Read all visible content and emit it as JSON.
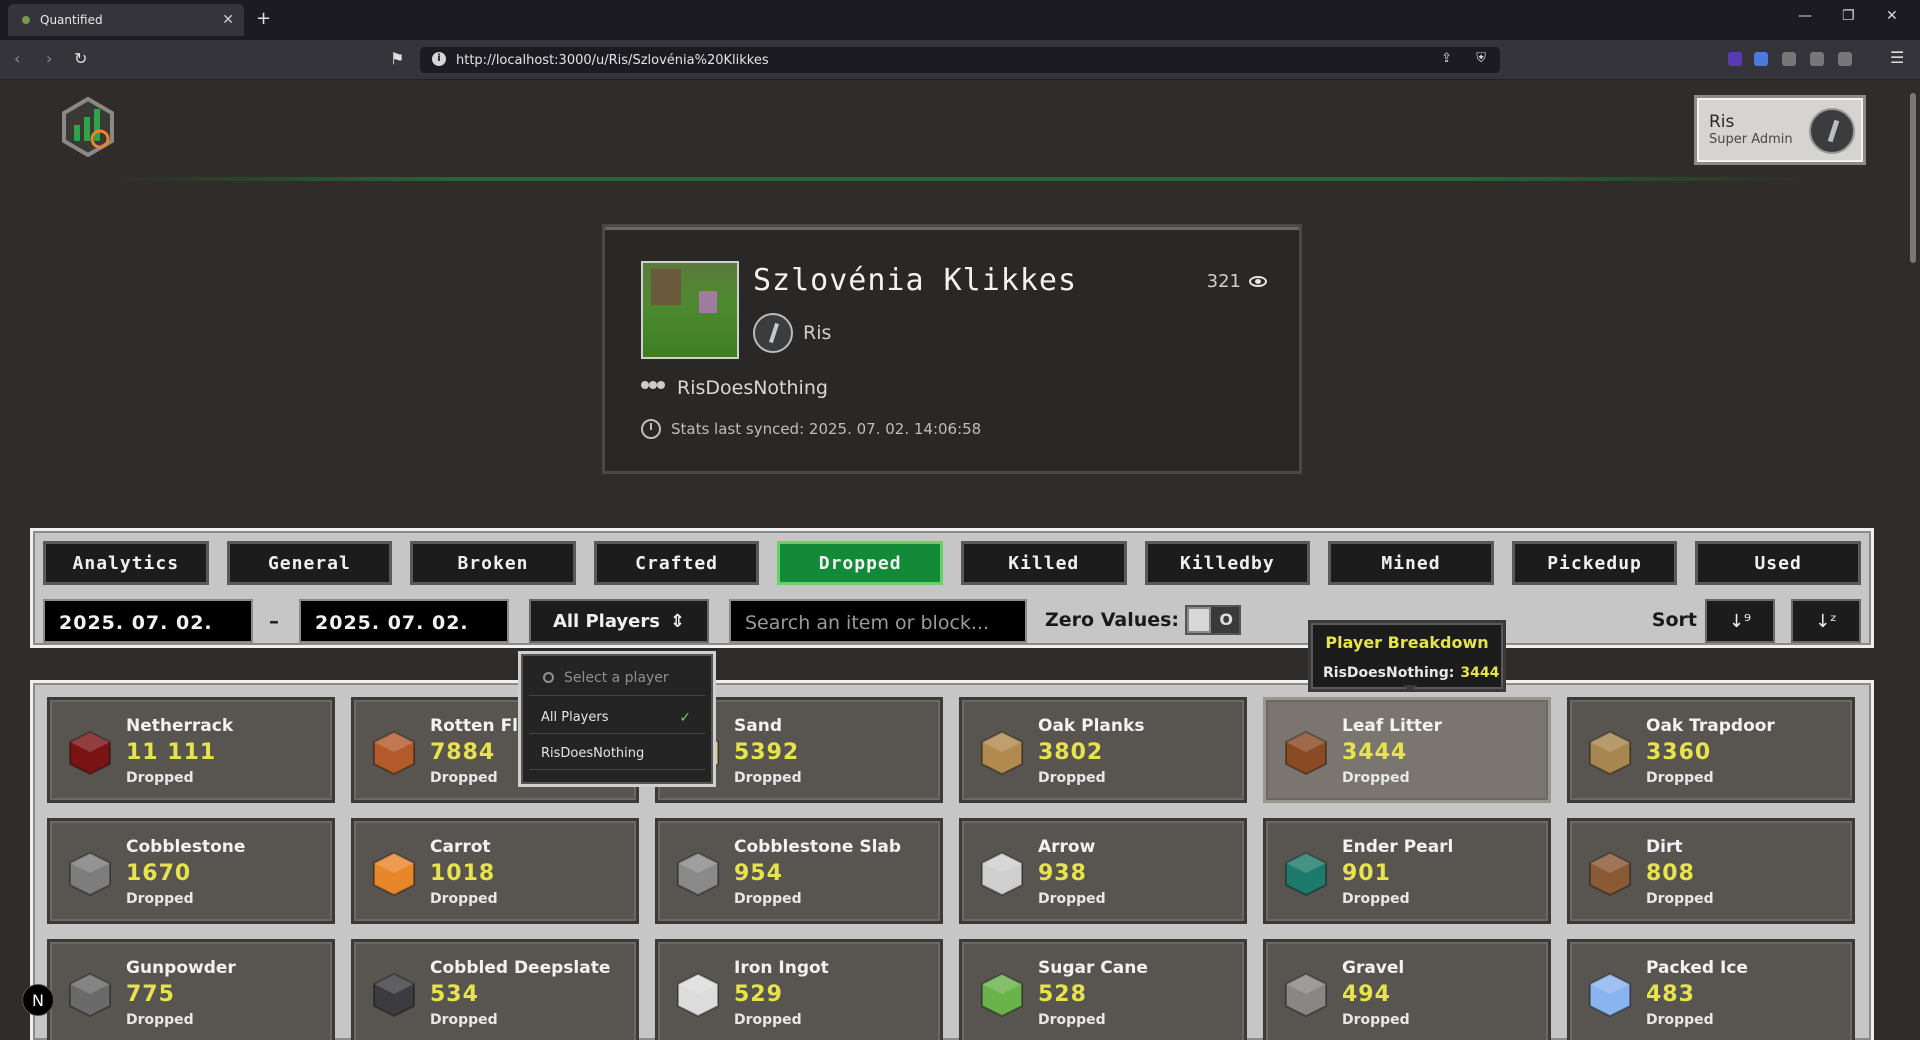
{
  "browser": {
    "tab_title": "Quantified",
    "url": "http://localhost:3000/u/Ris/Szlovénia%20Klikkes"
  },
  "user": {
    "name": "Ris",
    "role": "Super Admin"
  },
  "profile": {
    "name": "Szlovénia Klikkes",
    "views": "321",
    "owner": "Ris",
    "group": "RisDoesNothing",
    "synced": "Stats last synced: 2025. 07. 02. 14:06:58"
  },
  "tabs": [
    "Analytics",
    "General",
    "Broken",
    "Crafted",
    "Dropped",
    "Killed",
    "Killedby",
    "Mined",
    "Pickedup",
    "Used"
  ],
  "active_tab": "Dropped",
  "filters": {
    "date_from": "2025. 07. 02.",
    "date_to": "2025. 07. 02.",
    "dash": "–",
    "player_select": "All Players",
    "search_placeholder": "Search an item or block...",
    "zero_values_label": "Zero Values:",
    "zero_toggle_text": "O",
    "sort_label": "Sort"
  },
  "dropdown": {
    "search_placeholder": "Select a player",
    "items": [
      "All Players",
      "RisDoesNothing"
    ],
    "selected": "All Players"
  },
  "tooltip": {
    "title": "Player Breakdown",
    "player": "RisDoesNothing:",
    "value": "3444"
  },
  "items": [
    {
      "name": "Netherrack",
      "value": "11 111",
      "label": "Dropped",
      "icon": "netherrack-icon",
      "color": "#7a1414"
    },
    {
      "name": "Rotten Flesh",
      "value": "7884",
      "label": "Dropped",
      "icon": "rotten-flesh-icon",
      "color": "#b45a2a"
    },
    {
      "name": "Sand",
      "value": "5392",
      "label": "Dropped",
      "icon": "sand-icon",
      "color": "#dbcf8f"
    },
    {
      "name": "Oak Planks",
      "value": "3802",
      "label": "Dropped",
      "icon": "oak-planks-icon",
      "color": "#b08a4e"
    },
    {
      "name": "Leaf Litter",
      "value": "3444",
      "label": "Dropped",
      "icon": "leaf-litter-icon",
      "color": "#8a4a24"
    },
    {
      "name": "Oak Trapdoor",
      "value": "3360",
      "label": "Dropped",
      "icon": "oak-trapdoor-icon",
      "color": "#a88650"
    },
    {
      "name": "Cobblestone",
      "value": "1670",
      "label": "Dropped",
      "icon": "cobblestone-icon",
      "color": "#7d7d7d"
    },
    {
      "name": "Carrot",
      "value": "1018",
      "label": "Dropped",
      "icon": "carrot-icon",
      "color": "#e8862a"
    },
    {
      "name": "Cobblestone Slab",
      "value": "954",
      "label": "Dropped",
      "icon": "cobblestone-slab-icon",
      "color": "#8a8a8a"
    },
    {
      "name": "Arrow",
      "value": "938",
      "label": "Dropped",
      "icon": "arrow-icon",
      "color": "#cfcfcf"
    },
    {
      "name": "Ender Pearl",
      "value": "901",
      "label": "Dropped",
      "icon": "ender-pearl-icon",
      "color": "#1e7a6a"
    },
    {
      "name": "Dirt",
      "value": "808",
      "label": "Dropped",
      "icon": "dirt-icon",
      "color": "#8a5a34"
    },
    {
      "name": "Gunpowder",
      "value": "775",
      "label": "Dropped",
      "icon": "gunpowder-icon",
      "color": "#6a6a6a"
    },
    {
      "name": "Cobbled Deepslate",
      "value": "534",
      "label": "Dropped",
      "icon": "cobbled-deepslate-icon",
      "color": "#3c3c40"
    },
    {
      "name": "Iron Ingot",
      "value": "529",
      "label": "Dropped",
      "icon": "iron-ingot-icon",
      "color": "#dcdcdc"
    },
    {
      "name": "Sugar Cane",
      "value": "528",
      "label": "Dropped",
      "icon": "sugar-cane-icon",
      "color": "#6ab24a"
    },
    {
      "name": "Gravel",
      "value": "494",
      "label": "Dropped",
      "icon": "gravel-icon",
      "color": "#8a8684"
    },
    {
      "name": "Packed Ice",
      "value": "483",
      "label": "Dropped",
      "icon": "packed-ice-icon",
      "color": "#8ab4f0"
    }
  ],
  "colors": {
    "accent_green": "#138a37",
    "value_yellow": "#e6e34c"
  }
}
